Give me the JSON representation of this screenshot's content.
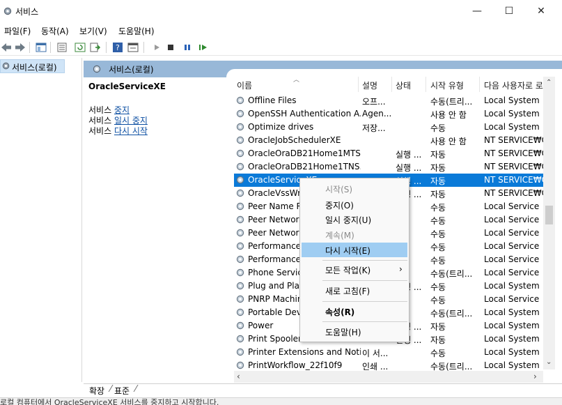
{
  "window": {
    "title": "서비스",
    "controls": {
      "minimize": "—",
      "maximize": "☐",
      "close": "✕"
    }
  },
  "menu": [
    "파일(F)",
    "동작(A)",
    "보기(V)",
    "도움말(H)"
  ],
  "tree": {
    "root_label": "서비스(로컬)"
  },
  "panel": {
    "header": "서비스(로컬)",
    "selected_service": "OracleServiceXE",
    "actions": [
      {
        "prefix": "서비스 ",
        "link": "중지"
      },
      {
        "prefix": "서비스 ",
        "link": "일시 중지"
      },
      {
        "prefix": "서비스 ",
        "link": "다시 시작"
      }
    ]
  },
  "columns": [
    "이름",
    "설명",
    "상태",
    "시작 유형",
    "다음 사용자로 로"
  ],
  "rows": [
    {
      "name": "Offline Files",
      "desc": "오프...",
      "status": "",
      "startup": "수동(트리...",
      "logon": "Local System"
    },
    {
      "name": "OpenSSH Authentication A...",
      "desc": "Agen...",
      "status": "",
      "startup": "사용 안 함",
      "logon": "Local System"
    },
    {
      "name": "Optimize drives",
      "desc": "저장...",
      "status": "",
      "startup": "수동",
      "logon": "Local System"
    },
    {
      "name": "OracleJobSchedulerXE",
      "desc": "",
      "status": "",
      "startup": "사용 안 함",
      "logon": "NT SERVICE₩Or"
    },
    {
      "name": "OracleOraDB21Home1MTS...",
      "desc": "",
      "status": "실행 ...",
      "startup": "자동",
      "logon": "NT SERVICE₩Or"
    },
    {
      "name": "OracleOraDB21Home1TNS...",
      "desc": "",
      "status": "실행 ...",
      "startup": "자동",
      "logon": "NT SERVICE₩Or"
    },
    {
      "name": "OracleServiceXE",
      "desc": "",
      "status": "실행 ...",
      "startup": "자동",
      "logon": "NT SERVICE₩Or"
    },
    {
      "name": "OracleVssWrit",
      "desc": "",
      "status": "실행 ...",
      "startup": "자동",
      "logon": "NT SERVICE₩Or"
    },
    {
      "name": "Peer Name Re",
      "desc": "",
      "status": "",
      "startup": "수동",
      "logon": "Local Service"
    },
    {
      "name": "Peer Networki",
      "desc": "",
      "status": "",
      "startup": "수동",
      "logon": "Local Service"
    },
    {
      "name": "Peer Networki",
      "desc": "",
      "status": "",
      "startup": "수동",
      "logon": "Local Service"
    },
    {
      "name": "Performance C",
      "desc": "",
      "status": "",
      "startup": "수동",
      "logon": "Local Service"
    },
    {
      "name": "Performance L",
      "desc": "",
      "status": "",
      "startup": "수동",
      "logon": "Local Service"
    },
    {
      "name": "Phone Service",
      "desc": "",
      "status": "",
      "startup": "수동(트리...",
      "logon": "Local Service"
    },
    {
      "name": "Plug and Play",
      "desc": "",
      "status": "실행 ...",
      "startup": "수동",
      "logon": "Local System"
    },
    {
      "name": "PNRP Machine",
      "desc": "",
      "status": "",
      "startup": "수동",
      "logon": "Local Service"
    },
    {
      "name": "Portable Devic",
      "desc": "",
      "status": "",
      "startup": "수동(트리...",
      "logon": "Local System"
    },
    {
      "name": "Power",
      "desc": "",
      "status": "실행 ...",
      "startup": "자동",
      "logon": "Local System"
    },
    {
      "name": "Print Spooler",
      "desc": "",
      "status": "실행 ...",
      "startup": "자동",
      "logon": "Local System"
    },
    {
      "name": "Printer Extensions and Noti...",
      "desc": "이 서...",
      "status": "",
      "startup": "수동",
      "logon": "Local System"
    },
    {
      "name": "PrintWorkflow_22f10f9",
      "desc": "인쇄 ...",
      "status": "",
      "startup": "수동(트리...",
      "logon": "Local System"
    }
  ],
  "context_menu": [
    {
      "label": "시작(S)",
      "state": "disabled"
    },
    {
      "label": "중지(O)",
      "state": "enabled"
    },
    {
      "label": "일시 중지(U)",
      "state": "enabled"
    },
    {
      "label": "계속(M)",
      "state": "disabled"
    },
    {
      "label": "다시 시작(E)",
      "state": "highlighted"
    },
    {
      "label": "모든 작업(K)",
      "state": "submenu"
    },
    {
      "label": "새로 고침(F)",
      "state": "enabled"
    },
    {
      "label": "속성(R)",
      "state": "bold"
    },
    {
      "label": "도움말(H)",
      "state": "enabled"
    }
  ],
  "bottom_tabs": [
    "확장",
    "표준"
  ],
  "status_text": "로컬 컴퓨터에서 OracleServiceXE 서비스를 중지하고 시작합니다.",
  "colors": {
    "selection": "#0a7ad8",
    "highlight": "#9fcdf2",
    "panel_header": "#98b8d8",
    "link": "#0b4ea2"
  }
}
